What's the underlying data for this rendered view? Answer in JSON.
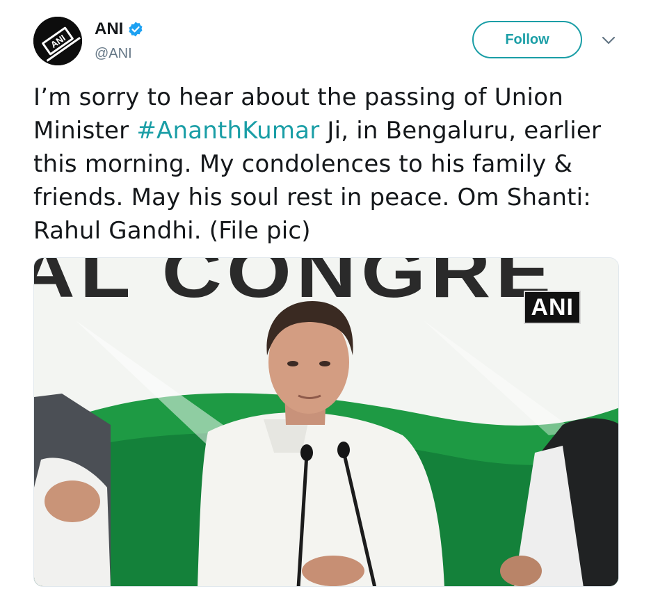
{
  "account": {
    "display_name": "ANI",
    "handle": "@ANI",
    "avatar_label": "ANI",
    "verified": true
  },
  "header": {
    "follow_label": "Follow",
    "menu_icon": "chevron-down-icon"
  },
  "tweet": {
    "text_before_hashtag": "I’m sorry to hear about the passing of Union Minister ",
    "hashtag": "#AnanthKumar",
    "text_after_hashtag": " Ji, in Bengaluru, earlier this morning. My condolences to his family & friends. May his soul rest in peace. Om Shanti: Rahul Gandhi. (File pic)"
  },
  "media": {
    "watermark": "ANI",
    "backdrop_text": "AL CONGRE"
  },
  "colors": {
    "accent": "#1a9ea6",
    "verified": "#1da1f2",
    "text": "#14171a",
    "secondary": "#657786",
    "backdrop_green": "#1e9a44"
  }
}
